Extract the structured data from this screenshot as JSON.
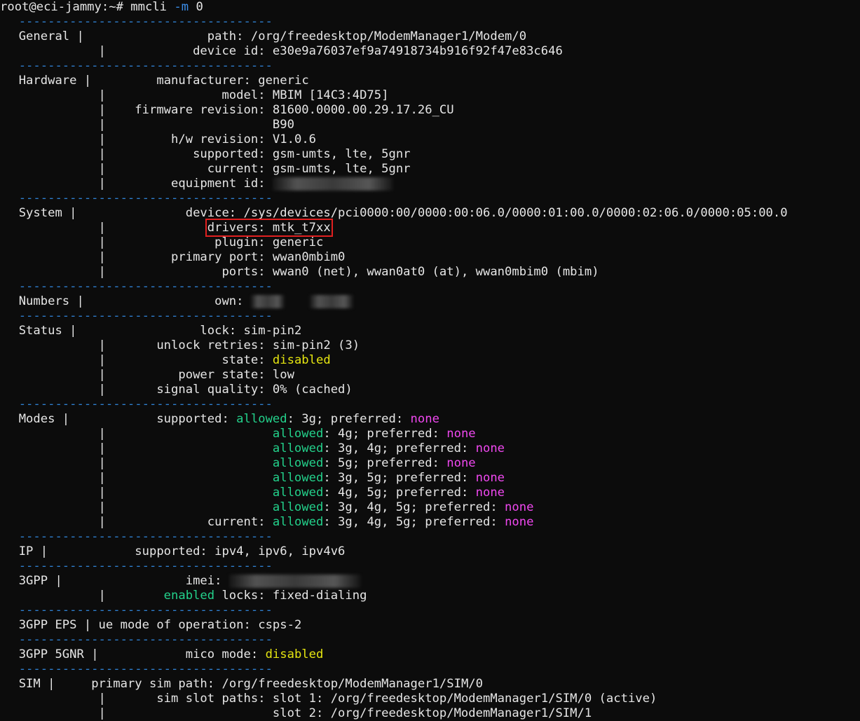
{
  "prompt": {
    "user_host": "root@eci-jammy:~#",
    "command": "mmcli",
    "flag": "-m",
    "arg": "0"
  },
  "separator": "-----------------------------------",
  "sections": {
    "general": {
      "title": "General",
      "path_key": "path",
      "path_val": "/org/freedesktop/ModemManager1/Modem/0",
      "devid_key": "device id",
      "devid_val": "e30e9a76037ef9a74918734b916f92f47e83c646"
    },
    "hardware": {
      "title": "Hardware",
      "manufacturer_key": "manufacturer",
      "manufacturer_val": "generic",
      "model_key": "model",
      "model_val": "MBIM [14C3:4D75]",
      "firmware_key": "firmware revision",
      "firmware_val1": "81600.0000.00.29.17.26_CU",
      "firmware_val2": "B90",
      "hw_key": "h/w revision",
      "hw_val": "V1.0.6",
      "supported_key": "supported",
      "supported_val": "gsm-umts, lte, 5gnr",
      "current_key": "current",
      "current_val": "gsm-umts, lte, 5gnr",
      "equipment_key": "equipment id"
    },
    "system": {
      "title": "System",
      "device_key": "device",
      "device_val": "/sys/devices/pci0000:00/0000:00:06.0/0000:01:00.0/0000:02:06.0/0000:05:00.0",
      "drivers_key": "drivers",
      "drivers_val": "mtk_t7xx",
      "plugin_key": "plugin",
      "plugin_val": "generic",
      "primary_port_key": "primary port",
      "primary_port_val": "wwan0mbim0",
      "ports_key": "ports",
      "ports_val": "wwan0 (net), wwan0at0 (at), wwan0mbim0 (mbim)"
    },
    "numbers": {
      "title": "Numbers",
      "own_key": "own"
    },
    "status": {
      "title": "Status",
      "lock_key": "lock",
      "lock_val": "sim-pin2",
      "retries_key": "unlock retries",
      "retries_val": "sim-pin2 (3)",
      "state_key": "state",
      "state_val": "disabled",
      "power_key": "power state",
      "power_val": "low",
      "signal_key": "signal quality",
      "signal_val": "0% (cached)"
    },
    "modes": {
      "title": "Modes",
      "supported_key": "supported",
      "current_key": "current",
      "allowed_word": "allowed",
      "preferred_word": "preferred",
      "none_word": "none",
      "supported": [
        "3g",
        "4g",
        "3g, 4g",
        "5g",
        "3g, 5g",
        "4g, 5g",
        "3g, 4g, 5g"
      ],
      "current": "3g, 4g, 5g"
    },
    "ip": {
      "title": "IP",
      "supported_key": "supported",
      "supported_val": "ipv4, ipv6, ipv4v6"
    },
    "gpp": {
      "title": "3GPP",
      "imei_key": "imei",
      "enabled_word": "enabled",
      "locks_key": "locks",
      "locks_val": "fixed-dialing"
    },
    "eps": {
      "title": "3GPP EPS",
      "ue_key": "ue mode of operation",
      "ue_val": "csps-2"
    },
    "nr5g": {
      "title": "3GPP 5GNR",
      "mico_key": "mico mode",
      "mico_val": "disabled"
    },
    "sim": {
      "title": "SIM",
      "primary_key": "primary sim path",
      "primary_val": "/org/freedesktop/ModemManager1/SIM/0",
      "slots_key": "sim slot paths",
      "slot1": "slot 1: /org/freedesktop/ModemManager1/SIM/0 (active)",
      "slot2": "slot 2: /org/freedesktop/ModemManager1/SIM/1"
    }
  },
  "colors": {
    "background": "#0c0c0c",
    "text": "#e6e6e6",
    "separator": "#2f7fd0",
    "green": "#23d18b",
    "yellow": "#e5e510",
    "magenta": "#f048f0",
    "highlight_box": "#e02020"
  }
}
